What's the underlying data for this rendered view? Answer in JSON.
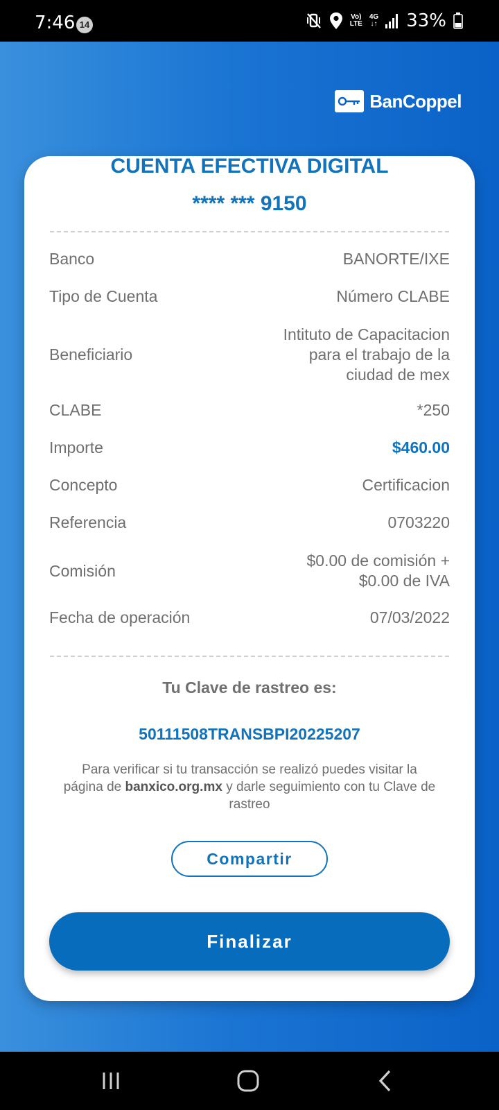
{
  "status_bar": {
    "time": "7:46",
    "notification_count": "14",
    "lte_top": "Vo)",
    "lte_bottom": "LTE",
    "network": "4G",
    "battery": "33%"
  },
  "brand": {
    "name": "BanCoppel"
  },
  "card": {
    "title": "CUENTA EFECTIVA DIGITAL",
    "account_number": "**** *** 9150",
    "rows": [
      {
        "label": "Banco",
        "value": "BANORTE/IXE"
      },
      {
        "label": "Tipo de Cuenta",
        "value": "Número CLABE"
      },
      {
        "label": "Beneficiario",
        "value": "Intituto de Capacitacion para el trabajo de la ciudad de mex"
      },
      {
        "label": "CLABE",
        "value": "*250"
      },
      {
        "label": "Importe",
        "value": "$460.00"
      },
      {
        "label": "Concepto",
        "value": "Certificacion"
      },
      {
        "label": "Referencia",
        "value": "0703220"
      },
      {
        "label": "Comisión",
        "value": "$0.00 de comisión + $0.00 de IVA"
      },
      {
        "label": "Fecha de operación",
        "value": "07/03/2022"
      }
    ],
    "clave_title": "Tu Clave de rastreo es:",
    "clave_value": "50111508TRANSBPI20225207",
    "verify_before": "Para verificar si tu transacción se realizó puedes visitar la página de",
    "verify_link": "banxico.org.mx",
    "verify_after": "y darle seguimiento con tu Clave de rastreo",
    "share_label": "Compartir",
    "finish_label": "Finalizar"
  },
  "colors": {
    "accent": "#1273bb",
    "button": "#076cbc",
    "background_gradient_start": "#3a90dd",
    "background_gradient_end": "#0a62c7"
  },
  "icons": {
    "status": [
      "mute-vibrate-icon",
      "location-icon",
      "signal-icon",
      "battery-icon"
    ],
    "nav": [
      "recent-apps-icon",
      "home-icon",
      "back-icon"
    ],
    "brand": "key-logo-icon"
  }
}
